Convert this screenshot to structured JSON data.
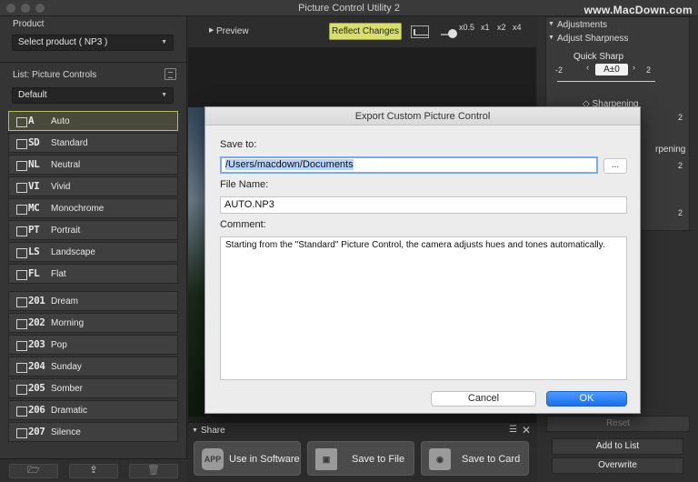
{
  "window": {
    "title": "Picture Control Utility 2",
    "watermark": "www.MacDown.com"
  },
  "left_panel": {
    "product_label": "Product",
    "product_value": "Select product ( NP3 )",
    "list_label": "List: Picture Controls",
    "filter_value": "Default",
    "items": [
      {
        "code": "A",
        "name": "Auto"
      },
      {
        "code": "SD",
        "name": "Standard"
      },
      {
        "code": "NL",
        "name": "Neutral"
      },
      {
        "code": "VI",
        "name": "Vivid"
      },
      {
        "code": "MC",
        "name": "Monochrome"
      },
      {
        "code": "PT",
        "name": "Portrait"
      },
      {
        "code": "LS",
        "name": "Landscape"
      },
      {
        "code": "FL",
        "name": "Flat"
      }
    ],
    "creative_items": [
      {
        "code": "201",
        "name": "Dream"
      },
      {
        "code": "202",
        "name": "Morning"
      },
      {
        "code": "203",
        "name": "Pop"
      },
      {
        "code": "204",
        "name": "Sunday"
      },
      {
        "code": "205",
        "name": "Somber"
      },
      {
        "code": "206",
        "name": "Dramatic"
      },
      {
        "code": "207",
        "name": "Silence"
      }
    ]
  },
  "center": {
    "preview_label": "Preview",
    "reflect_button": "Reflect Changes",
    "zoom_levels": [
      "x0.5",
      "x1",
      "x2",
      "x4"
    ],
    "share_title": "Share",
    "share_buttons": [
      "Use in Software",
      "Save to File",
      "Save to Card"
    ],
    "app_icon_text": "APP"
  },
  "right_panel": {
    "adjustments_label": "Adjustments",
    "adjust_sharpness_label": "Adjust Sharpness",
    "quick_sharp_label": "Quick Sharp",
    "quick_sharp_value": "A±0",
    "quick_sharp_min": "-2",
    "quick_sharp_max": "2",
    "sharpening_label": "Sharpening",
    "sharpening_partial": "rpening",
    "scale_max": "2",
    "reset_button": "Reset",
    "add_to_list_button": "Add to List",
    "overwrite_button": "Overwrite"
  },
  "dialog": {
    "title": "Export Custom Picture Control",
    "save_to_label": "Save to:",
    "save_to_value": "/Users/macdown/Documents",
    "browse_button": "...",
    "file_name_label": "File Name:",
    "file_name_value": "AUTO.NP3",
    "comment_label": "Comment:",
    "comment_value": "Starting from the \"Standard\" Picture Control, the camera adjusts hues and tones automatically.",
    "cancel_button": "Cancel",
    "ok_button": "OK"
  },
  "colors": {
    "accent_yellow": "#d8e06a",
    "ok_blue": "#1a6ef2",
    "selection_border": "#b9bd52"
  }
}
